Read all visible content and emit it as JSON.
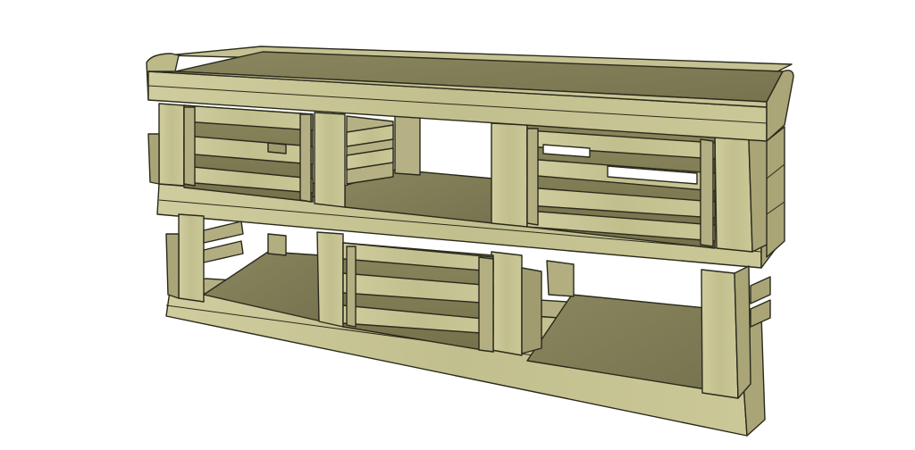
{
  "diagram": {
    "subject": "wooden-crate-console-table",
    "style": "3d-sketch-render",
    "colors": {
      "background": "#ffffff",
      "wood_light": "#c8c698",
      "wood_mid": "#b9b585",
      "wood_dark": "#8f8b60",
      "wood_shadow": "#6d6a47",
      "top_surface": "#7f7b55",
      "outline": "#2a2a1c"
    }
  }
}
